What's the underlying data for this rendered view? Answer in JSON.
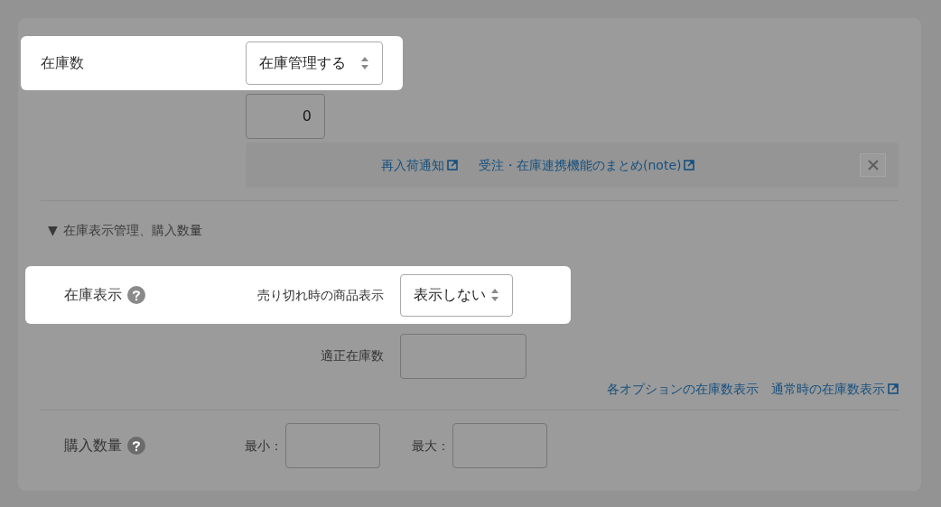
{
  "stock": {
    "label": "在庫数",
    "highlighted": true,
    "select": "在庫管理する",
    "quantity": "0"
  },
  "notice": {
    "links": [
      {
        "text": "再入荷通知",
        "external": true
      },
      {
        "text": "受注・在庫連携機能のまとめ(note)",
        "external": true
      }
    ]
  },
  "disclosure": {
    "marker": "▼",
    "label": "在庫表示管理、購入数量",
    "expanded": true
  },
  "display": {
    "label": "在庫表示",
    "highlighted": true,
    "select_label": "売り切れ時の商品表示",
    "select": "表示しない",
    "proper_label": "適正在庫数",
    "links": [
      {
        "text": "各オプションの在庫数表示",
        "external": false
      },
      {
        "text": "通常時の在庫数表示",
        "external": true
      }
    ]
  },
  "purchase": {
    "label": "購入数量",
    "min_label": "最小：",
    "max_label": "最大："
  }
}
